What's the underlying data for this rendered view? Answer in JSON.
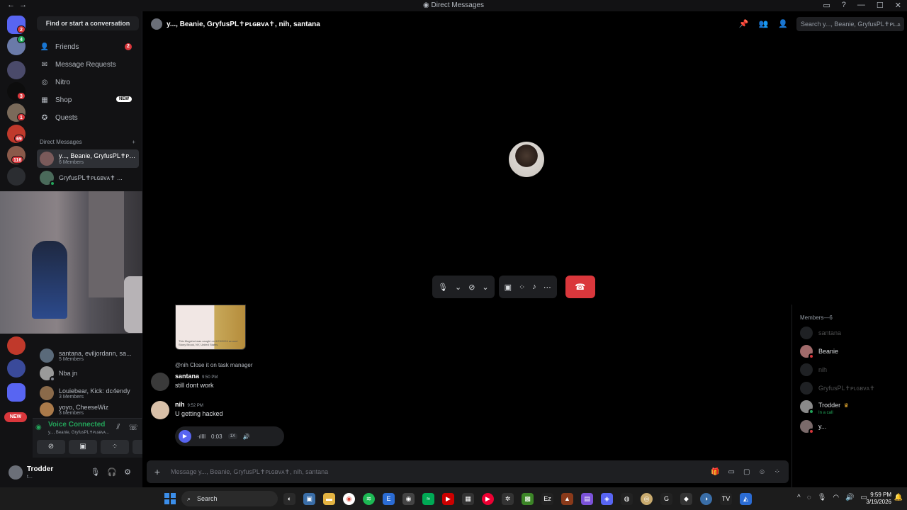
{
  "window": {
    "title": "Direct Messages",
    "back": "←",
    "forward": "→",
    "controls": [
      "▭",
      "?",
      "—",
      "☐",
      "✕"
    ]
  },
  "guilds": {
    "badges": [
      "2",
      "4",
      "3",
      "1",
      "69",
      "116"
    ],
    "new_label": "NEW"
  },
  "sidebar": {
    "search_button": "Find or start a conversation",
    "nav": [
      {
        "label": "Friends",
        "icon": "friends-icon",
        "badge": "2"
      },
      {
        "label": "Message Requests",
        "icon": "mail-icon"
      },
      {
        "label": "Nitro",
        "icon": "nitro-icon"
      },
      {
        "label": "Shop",
        "icon": "shop-icon",
        "tag": "NEW"
      },
      {
        "label": "Quests",
        "icon": "quests-icon"
      }
    ],
    "dm_header": "Direct Messages",
    "dm_add": "+",
    "dms": [
      {
        "name": "y..., Beanie, GryfusPL✝ᴘʟɢʙᴠᴀ✝...",
        "sub": "6 Members",
        "active": true
      },
      {
        "name": "GryfusPL✝ᴘʟɢʙᴠᴀ✝ ...",
        "sub": ""
      },
      {
        "name": "santana, eviljordann, sa...",
        "sub": "5 Members"
      },
      {
        "name": "Nba jn",
        "sub": ""
      },
      {
        "name": "Louiebear, Kick: dc4endy",
        "sub": "3 Members"
      },
      {
        "name": "yoyo, CheeseWiz",
        "sub": "3 Members"
      }
    ]
  },
  "voice": {
    "title": "Voice Connected",
    "channel": "y..., Beanie, GryfusPL✝ᴘʟɢʙᴠᴀ...",
    "buttons": [
      "camera-off-icon",
      "screen-share-icon",
      "activities-icon",
      "soundboard-icon"
    ]
  },
  "user": {
    "name": "Trodder",
    "status": "t..."
  },
  "header": {
    "title": "y..., Beanie, GryfusPL✝ᴘʟɢʙᴠᴀ✝, nih, santana",
    "search_placeholder": "Search y..., Beanie, GryfusPL✝ᴘʟ..."
  },
  "call": {
    "controls": [
      "mic-icon",
      "chevron-down-icon",
      "camera-off-icon",
      "chevron-down-icon",
      "screen-share-icon",
      "activities-icon",
      "soundboard-icon",
      "more-icon"
    ],
    "end_label": "☎"
  },
  "chat": {
    "image_caption": "This Mugshot was caught on 6/23/2024 around Stony Brook, NY, United States.",
    "reply": "@nih Close it on task manager",
    "messages": [
      {
        "author": "santana",
        "time": "9:50 PM",
        "body": "still dont work"
      },
      {
        "author": "nih",
        "time": "9:52 PM",
        "body": "U getting hacked"
      }
    ],
    "voice_message": {
      "duration": "0:03",
      "speed": "1X"
    },
    "composer_placeholder": "Message y..., Beanie, GryfusPL✝ᴘʟɢʙᴠᴀ✝, nih, santana"
  },
  "members": {
    "header": "Members—6",
    "list": [
      {
        "name": "santana",
        "offline": true
      },
      {
        "name": "Beanie",
        "offline": false
      },
      {
        "name": "nih",
        "offline": true
      },
      {
        "name": "GryfusPL✝ᴘʟɢʙᴠᴀ✝",
        "offline": true
      },
      {
        "name": "Trodder",
        "sub": "In a call",
        "offline": false
      },
      {
        "name": "y...",
        "offline": false
      }
    ]
  },
  "taskbar": {
    "search": "Search",
    "time": "9:59 PM",
    "date": "3/19/2026"
  }
}
